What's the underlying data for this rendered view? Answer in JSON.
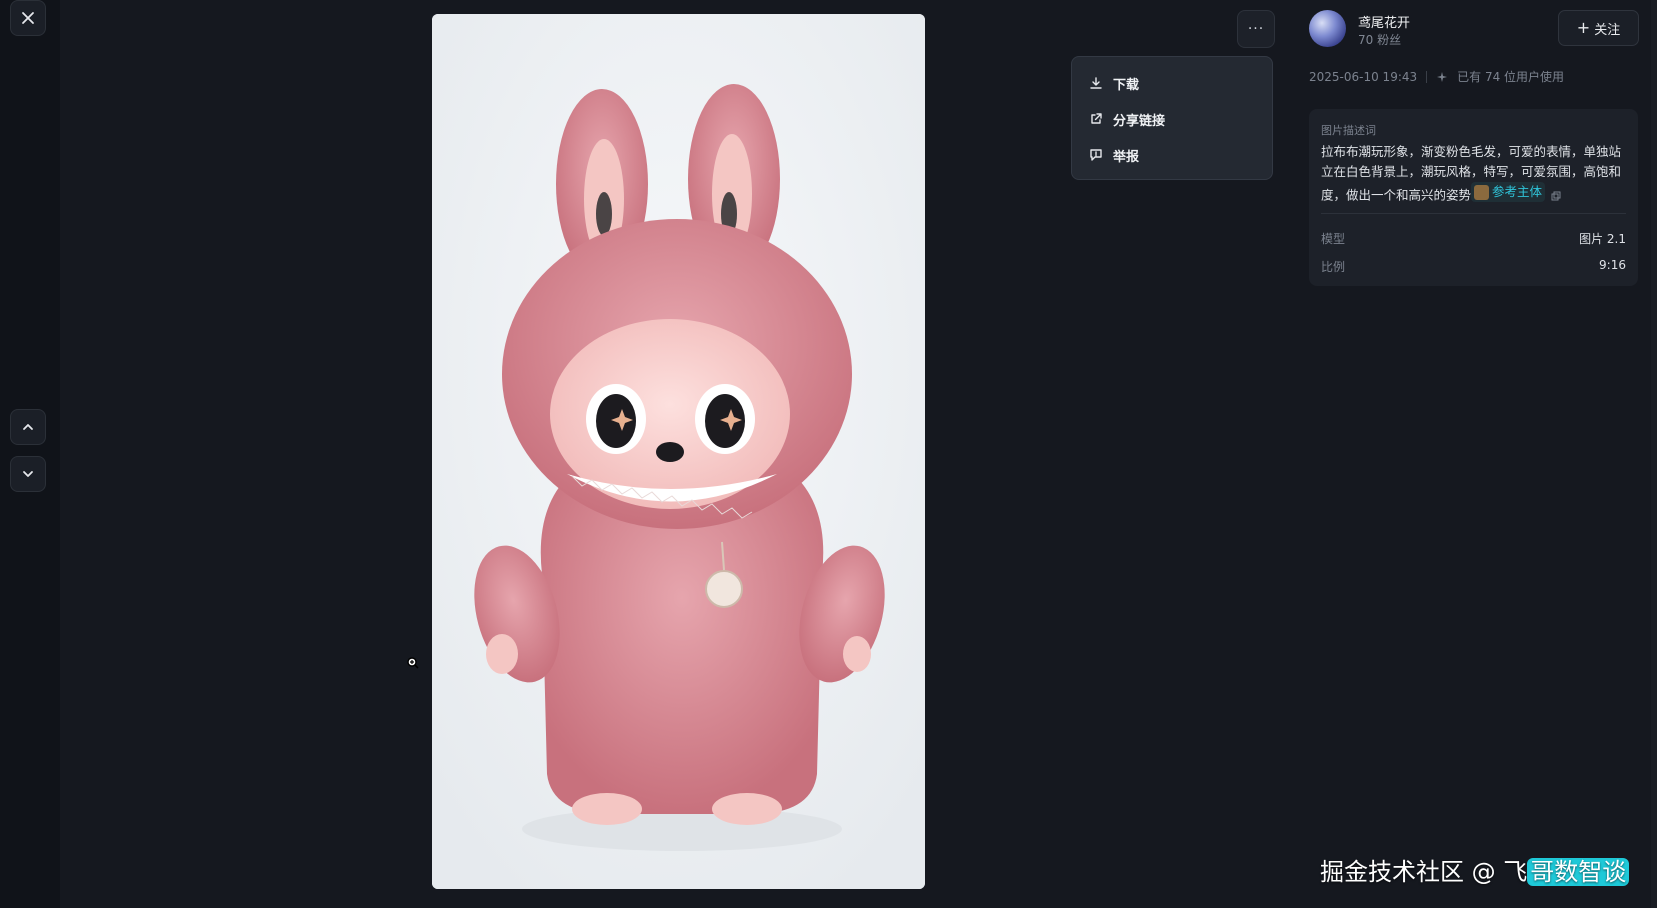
{
  "nav": {
    "close_icon": "close-icon",
    "prev_icon": "chevron-up-icon",
    "next_icon": "chevron-down-icon"
  },
  "more_button": {
    "label": "···"
  },
  "menu": {
    "items": [
      {
        "label": "下载",
        "icon": "download-icon"
      },
      {
        "label": "分享链接",
        "icon": "share-link-icon"
      },
      {
        "label": "举报",
        "icon": "report-icon"
      }
    ]
  },
  "author": {
    "name": "鸢尾花开",
    "fans": "70 粉丝",
    "follow_label": "关注"
  },
  "meta": {
    "date": "2025-06-10 19:43",
    "usage": "已有 74 位用户使用"
  },
  "details": {
    "desc_title": "图片描述词",
    "desc_text": "拉布布潮玩形象，渐变粉色毛发，可爱的表情，单独站立在白色背景上，潮玩风格，特写，可爱氛围，高饱和度，做出一个和高兴的姿势",
    "ref_label": "参考主体",
    "model_label": "模型",
    "model_value": "图片 2.1",
    "ratio_label": "比例",
    "ratio_value": "9:16"
  },
  "watermark": {
    "text": "掘金技术社区 @ 飞",
    "highlight": "哥数智谈"
  },
  "colors": {
    "background": "#15181f",
    "panel": "#1d2129",
    "accent": "#2fc4d9",
    "figure_pink": "#d98f97"
  }
}
